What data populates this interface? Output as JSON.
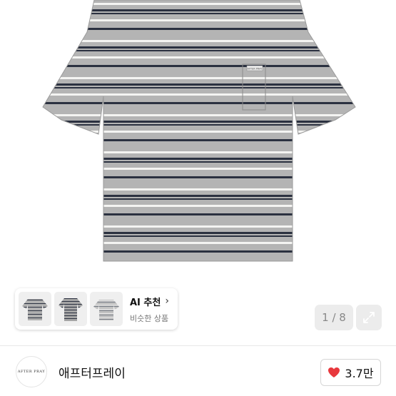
{
  "product": {
    "image_desc": "grey striped t-shirt",
    "pocket_tag": "AFTER PRAY"
  },
  "ai_recommend": {
    "title": "AI 추천",
    "chevron": "›",
    "subtitle": "비슷한 상품",
    "thumbnails": [
      "striped-tshirt-1",
      "striped-tshirt-2",
      "striped-tshirt-3"
    ]
  },
  "gallery": {
    "counter": "1 / 8",
    "expand_icon": "expand-icon"
  },
  "shop": {
    "logo_text": "AFTER PRAY",
    "name": "애프터프레이"
  },
  "like": {
    "icon": "heart-icon",
    "count": "3.7만",
    "color": "#e8383d"
  },
  "colors": {
    "shirt_base": "#b4b4b4",
    "stripe_navy": "#2b3140",
    "stripe_white": "#f4f4f2"
  }
}
